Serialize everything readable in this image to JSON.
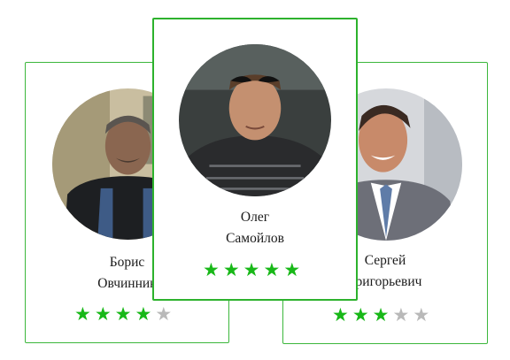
{
  "colors": {
    "border": "#3cb73c",
    "star_on": "#18b818",
    "star_off": "#b9b9b9"
  },
  "cards": [
    {
      "first_name": "Борис",
      "last_name": "Овчинник",
      "rating": 4,
      "max_rating": 5,
      "photo": "man-with-mustache-overalls"
    },
    {
      "first_name": "Олег",
      "last_name": "Самойлов",
      "rating": 5,
      "max_rating": 5,
      "photo": "man-with-sunglasses-on-head"
    },
    {
      "first_name": "Сергей",
      "last_name": "Григорьевич",
      "rating": 3,
      "max_rating": 5,
      "photo": "man-in-suit-and-tie"
    }
  ]
}
